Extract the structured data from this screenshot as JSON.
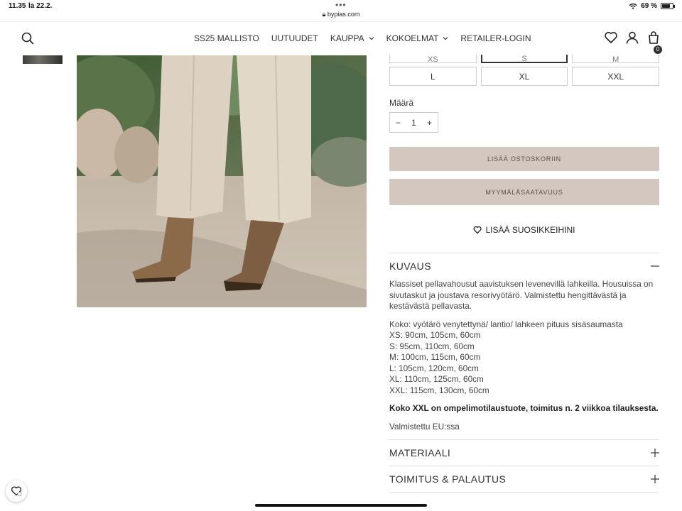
{
  "status": {
    "time": "11.35",
    "date": "la 22.2.",
    "url": "bypias.com",
    "battery": "69 %"
  },
  "nav": {
    "items": [
      {
        "label": "SS25 MALLISTO",
        "dropdown": false
      },
      {
        "label": "UUTUUDET",
        "dropdown": false
      },
      {
        "label": "KAUPPA",
        "dropdown": true
      },
      {
        "label": "KOKOELMAT",
        "dropdown": true
      },
      {
        "label": "RETAILER-LOGIN",
        "dropdown": false
      }
    ],
    "cart_count": "0"
  },
  "sizes": {
    "row1": [
      "XS",
      "S",
      "M"
    ],
    "row1_selected": "S",
    "row2": [
      "L",
      "XL",
      "XXL"
    ]
  },
  "quantity": {
    "label": "Määrä",
    "value": "1",
    "minus": "−",
    "plus": "+"
  },
  "buttons": {
    "add_to_cart": "LISÄÄ OSTOSKORIIN",
    "store_availability": "MYYMÄLÄSAATAVUUS",
    "add_favorite": "LISÄÄ SUOSIKKEIHINI"
  },
  "kuvaus": {
    "title": "KUVAUS",
    "intro": "Klassiset pellavahousut aavistuksen levenevillä lahkeilla. Housuissa on sivutaskut ja joustava resorivyötärö. Valmistettu hengittävästä ja kestävästä pellavasta.",
    "size_title": "Koko: vyötärö venytettynä/ lantio/ lahkeen pituus sisäsaumasta",
    "size_lines": [
      "XS: 90cm, 105cm, 60cm",
      "S: 95cm, 110cm, 60cm",
      "M: 100cm, 115cm, 60cm",
      "L: 105cm, 120cm, 60cm",
      "XL: 110cm, 125cm, 60cm",
      "XXL: 115cm, 130cm, 60cm"
    ],
    "note": "Koko XXL on ompelimotilaustuote, toimitus n. 2 viikkoa tilauksesta.",
    "made_in": "Valmistettu EU:ssa"
  },
  "sections": {
    "materiaali": "MATERIAALI",
    "toimitus": "TOIMITUS & PALAUTUS"
  }
}
